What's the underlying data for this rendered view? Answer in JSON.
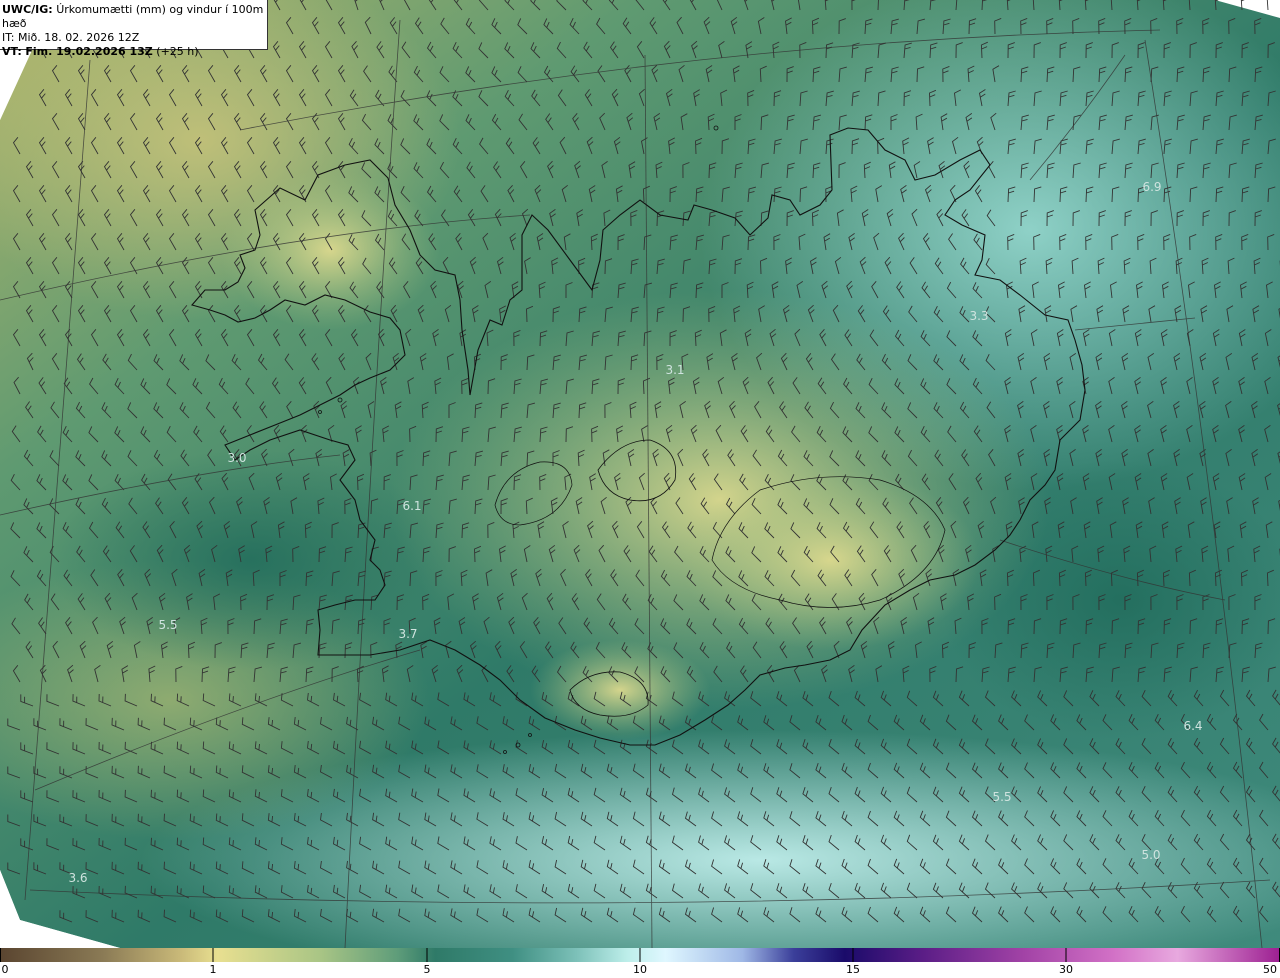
{
  "header": {
    "product_code": "UWC/IG:",
    "title": "Úrkomumætti (mm) og vindur í 100m hæð",
    "init_line": "IT: Mið. 18. 02. 2026 12Z",
    "valid_prefix": "VT:",
    "valid_bold": "Fim. 19.02.2026 13Z",
    "valid_suffix": "(+25 h)"
  },
  "value_labels": [
    "6.9",
    "3.3",
    "3.1",
    "3.0",
    "6.1",
    "5.5",
    "3.7",
    "6.4",
    "5.5",
    "5.0",
    "3.6"
  ],
  "colorbar": {
    "ticks": [
      "0",
      "1",
      "5",
      "10",
      "15",
      "30",
      "50"
    ],
    "colors": [
      "#5a4530",
      "#8a7a55",
      "#c8b878",
      "#e8df90",
      "#a9c585",
      "#5f9d7a",
      "#2f7a68",
      "#3f8f82",
      "#7cc0b8",
      "#bdeeea",
      "#dff7ff",
      "#9fb8e6",
      "#3b3f9a",
      "#1a0b6a",
      "#5a1d86",
      "#a243a6",
      "#d271c6",
      "#e8a9df"
    ]
  },
  "colors": {
    "ocean_deep": "#2e7a68",
    "ocean_light": "#8fd3cc",
    "land_low": "#2f7a68",
    "land_high": "#d6d88c",
    "coast": "#111111",
    "grid": "#333333",
    "barb": "#333333"
  }
}
